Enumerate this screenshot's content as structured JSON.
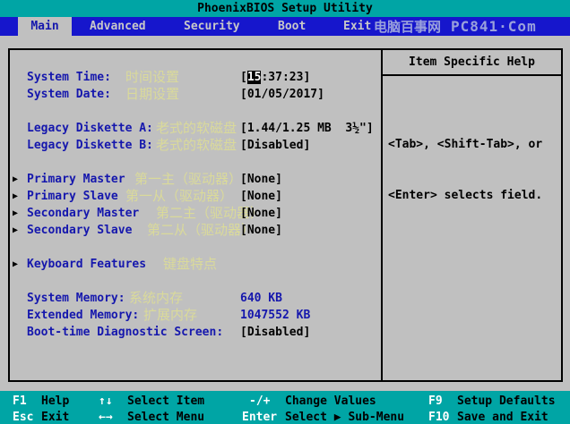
{
  "title_bar": {
    "title": "PhoenixBIOS Setup Utility"
  },
  "menu_bar": {
    "tabs": [
      {
        "label": "Main",
        "selected": true
      },
      {
        "label": "Advanced",
        "selected": false
      },
      {
        "label": "Security",
        "selected": false
      },
      {
        "label": "Boot",
        "selected": false
      },
      {
        "label": "Exit",
        "selected": false
      }
    ],
    "watermark_cn": "电脑百事网",
    "watermark_site": "PC841·Com"
  },
  "icons": {
    "submenu_arrow": "▶",
    "up_down": "↑↓",
    "left_right": "←→"
  },
  "main_panel": {
    "rows": [
      {
        "label": "System Time:",
        "cn": "时间设置",
        "value_open": "[",
        "cursor": "15",
        "value_rest": ":37:23]"
      },
      {
        "label": "System Date:",
        "cn": "日期设置",
        "value": "[01/05/2017]"
      },
      {
        "label": "Legacy Diskette A:",
        "cn": "老式的软磁盘",
        "value": "[1.44/1.25 MB  3½\"]"
      },
      {
        "label": "Legacy Diskette B:",
        "cn": "老式的软磁盘",
        "value": "[Disabled]"
      },
      {
        "label": "Primary Master",
        "cn": "第一主（驱动器）",
        "value": "[None]"
      },
      {
        "label": "Primary Slave",
        "cn": "第一从（驱动器）",
        "value": "[None]"
      },
      {
        "label": "Secondary Master",
        "cn": "第二主（驱动器）",
        "value": "[None]"
      },
      {
        "label": "Secondary Slave",
        "cn": "第二从（驱动器）",
        "value": "[None]"
      },
      {
        "label": "Keyboard Features",
        "cn": "键盘特点"
      },
      {
        "label": "System Memory:",
        "cn": "系统内存",
        "value": "640 KB"
      },
      {
        "label": "Extended Memory:",
        "cn": "扩展内存",
        "value": "1047552 KB"
      },
      {
        "label": "Boot-time Diagnostic Screen:",
        "value": "[Disabled]"
      }
    ]
  },
  "help_panel": {
    "title": "Item Specific Help",
    "lines": [
      "<Tab>, <Shift-Tab>, or",
      "<Enter> selects field."
    ]
  },
  "footer": {
    "hints": [
      {
        "key": "F1",
        "label": "Help"
      },
      {
        "key": "↑↓",
        "label": "Select Item"
      },
      {
        "key": "-/+",
        "label": "Change Values"
      },
      {
        "key": "F9",
        "label": "Setup Defaults"
      },
      {
        "key": "Esc",
        "label": "Exit"
      },
      {
        "key": "←→",
        "label": "Select Menu"
      },
      {
        "key": "Enter",
        "label": "Select ▶ Sub-Menu"
      },
      {
        "key": "F10",
        "label": "Save and Exit"
      }
    ]
  },
  "colors": {
    "teal": "#00A5A5",
    "menu_blue": "#1616CC",
    "panel_gray": "#C0C0C0",
    "label_blue": "#1517AD",
    "annotation_yellow": "#DADA9A",
    "value_black": "#000000",
    "watermark": "#9AA1DC"
  }
}
